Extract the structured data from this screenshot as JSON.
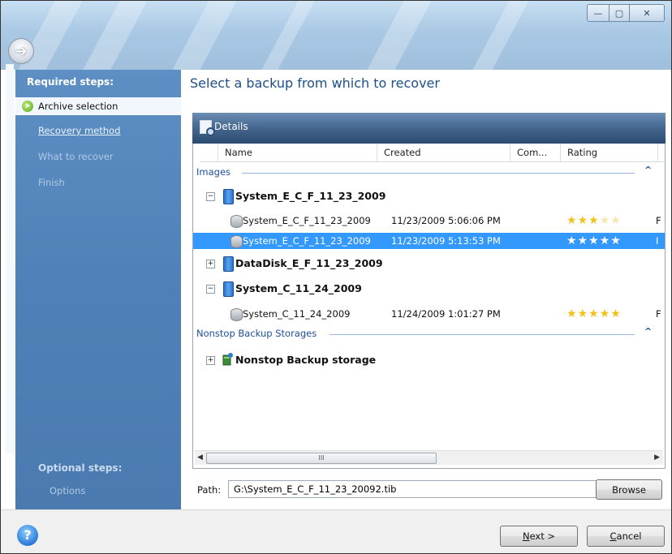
{
  "window": {
    "controls": {
      "minimize": "—",
      "maximize": "▢",
      "close": "✕"
    }
  },
  "sidebar": {
    "required_title": "Required steps:",
    "steps": [
      {
        "label": "Archive selection",
        "state": "active"
      },
      {
        "label": "Recovery method",
        "state": "link"
      },
      {
        "label": "What to recover",
        "state": "disabled"
      },
      {
        "label": "Finish",
        "state": "disabled"
      }
    ],
    "optional_title": "Optional steps:",
    "optional_items": [
      {
        "label": "Options",
        "state": "disabled"
      }
    ]
  },
  "main": {
    "title": "Select a backup from which to recover",
    "details_label": "Details",
    "columns": [
      "Name",
      "Created",
      "Com...",
      "Rating"
    ],
    "groups": [
      {
        "label": "Images",
        "collapse": "^",
        "nodes": [
          {
            "name": "System_E_C_F_11_23_2009",
            "expanded": true,
            "expander": "−",
            "backups": [
              {
                "name": "System_E_C_F_11_23_2009",
                "created": "11/23/2009 5:06:06 PM",
                "rating": 3,
                "more": "F",
                "selected": false
              },
              {
                "name": "System_E_C_F_11_23_2009",
                "created": "11/23/2009 5:13:53 PM",
                "rating": 5,
                "more": "I",
                "selected": true
              }
            ]
          },
          {
            "name": "DataDisk_E_F_11_23_2009",
            "expanded": false,
            "expander": "+"
          },
          {
            "name": "System_C_11_24_2009",
            "expanded": true,
            "expander": "−",
            "backups": [
              {
                "name": "System_C_11_24_2009",
                "created": "11/24/2009 1:01:27 PM",
                "rating": 5,
                "more": "F",
                "selected": false
              }
            ]
          }
        ]
      },
      {
        "label": "Nonstop Backup Storages",
        "collapse": "^",
        "nodes": [
          {
            "name": "Nonstop Backup storage",
            "expanded": false,
            "expander": "+"
          }
        ]
      }
    ],
    "scroll_thumb": "III",
    "path_label": "Path:",
    "path_value": "G:\\System_E_C_F_11_23_20092.tib",
    "browse_label": "Browse"
  },
  "footer": {
    "help": "?",
    "next_prefix": "N",
    "next_rest": "ext >",
    "cancel_prefix": "C",
    "cancel_rest": "ancel"
  },
  "colors": {
    "sidebar": "#4f81b8",
    "selection": "#3399ff",
    "accent_text": "#1e4f9a",
    "details_bar": "#3a5b82"
  },
  "icons": [
    "back-arrow-icon",
    "help-icon",
    "details-icon",
    "disk-icon",
    "tib-file-icon",
    "nonstop-storage-icon",
    "star-icon"
  ]
}
